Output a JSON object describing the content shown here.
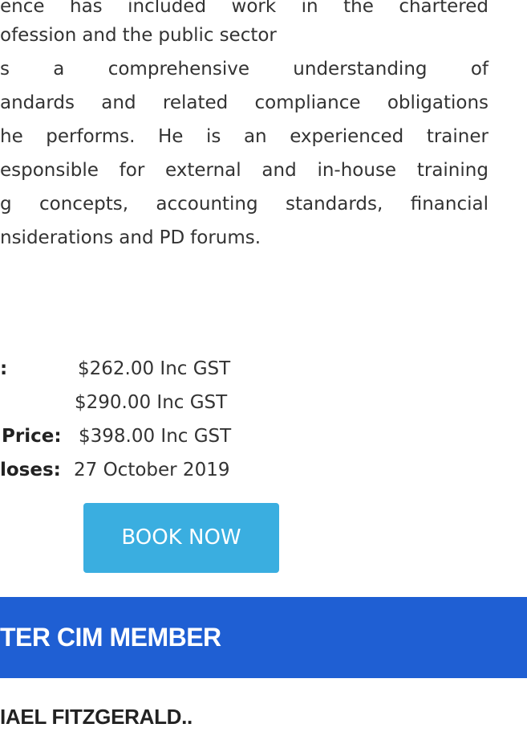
{
  "bio": {
    "lines": [
      "ence has included work in the chartered",
      "ofession and the public sector",
      "s a comprehensive understanding of",
      "andards and related compliance obligations",
      "he performs. He is an experienced trainer",
      "esponsible for external and in-house training",
      "g concepts, accounting standards, financial",
      "nsiderations and PD forums."
    ]
  },
  "pricing": {
    "rows": [
      {
        "label": ":",
        "value": "$262.00 Inc GST"
      },
      {
        "label": "",
        "value": "$290.00 Inc GST"
      },
      {
        "label": "Price:",
        "value": "$398.00  Inc GST"
      },
      {
        "label": "loses:",
        "value": "27 October 2019"
      }
    ]
  },
  "cta": {
    "book_label": "BOOK NOW"
  },
  "banner": {
    "text": "TER CIM MEMBER",
    "color": "#1f5fd3"
  },
  "bottom": {
    "heading": "IAEL FITZGERALD.."
  },
  "colors": {
    "button": "#3aaee0",
    "text": "#333333"
  }
}
